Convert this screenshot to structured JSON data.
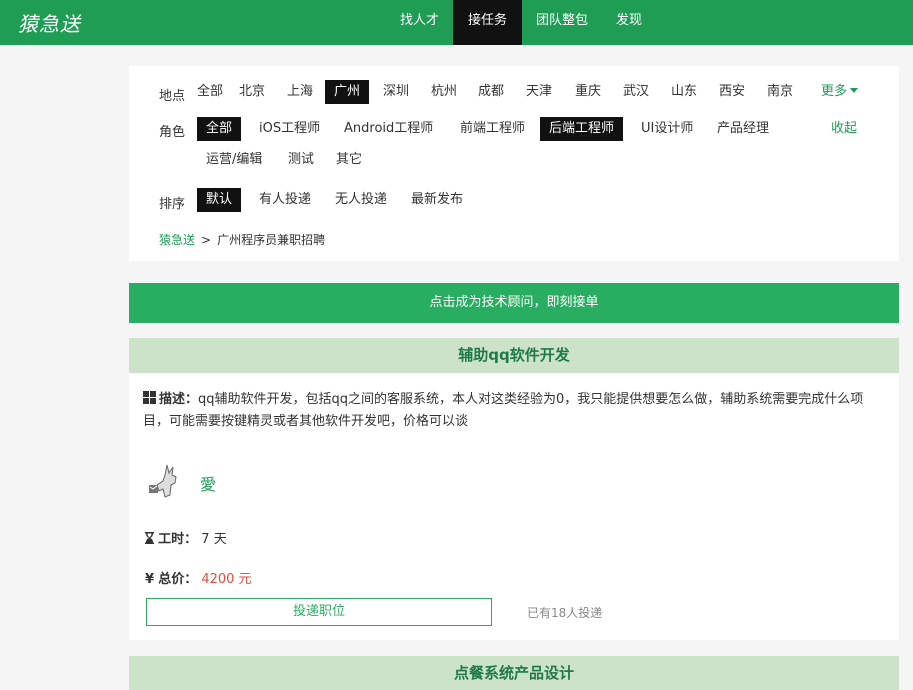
{
  "header": {
    "logo": "猿急送",
    "nav": [
      {
        "label": "找人才",
        "active": false
      },
      {
        "label": "接任务",
        "active": true
      },
      {
        "label": "团队整包",
        "active": false
      },
      {
        "label": "发现",
        "active": false
      }
    ]
  },
  "filters": {
    "location": {
      "label": "地点",
      "items": [
        "全部",
        "北京",
        "上海",
        "广州",
        "深圳",
        "杭州",
        "成都",
        "天津",
        "重庆",
        "武汉",
        "山东",
        "西安",
        "南京"
      ],
      "selected": "广州",
      "more": "更多"
    },
    "role": {
      "label": "角色",
      "items": [
        "全部",
        "iOS工程师",
        "Android工程师",
        "前端工程师",
        "后端工程师",
        "UI设计师",
        "产品经理",
        "运营/编辑",
        "测试",
        "其它"
      ],
      "selected": [
        "全部",
        "后端工程师"
      ],
      "collapse": "收起"
    },
    "sort": {
      "label": "排序",
      "items": [
        "默认",
        "有人投递",
        "无人投递",
        "最新发布"
      ],
      "selected": "默认"
    }
  },
  "breadcrumb": {
    "home": "猿急送",
    "separator": ">",
    "current": "广州程序员兼职招聘"
  },
  "banner": "点击成为技术顾问，即刻接单",
  "tasks": [
    {
      "title": "辅助qq软件开发",
      "desc_label": "描述：",
      "desc": "qq辅助软件开发，包括qq之间的客服系统，本人对这类经验为0，我只能提供想要怎么做，辅助系统需要完成什么项目，可能需要按键精灵或者其他软件开发吧，价格可以谈",
      "user": "愛",
      "duration_label": "工时：",
      "duration": "7 天",
      "price_label": "总价：",
      "price": "4200 元",
      "apply": "投递职位",
      "applied": "已有18人投递"
    },
    {
      "title": "点餐系统产品设计"
    }
  ],
  "colors": {
    "brand": "#1f9d55",
    "banner": "#27ae60",
    "task_header_bg": "#cde3c9",
    "price": "#e74c3c"
  }
}
